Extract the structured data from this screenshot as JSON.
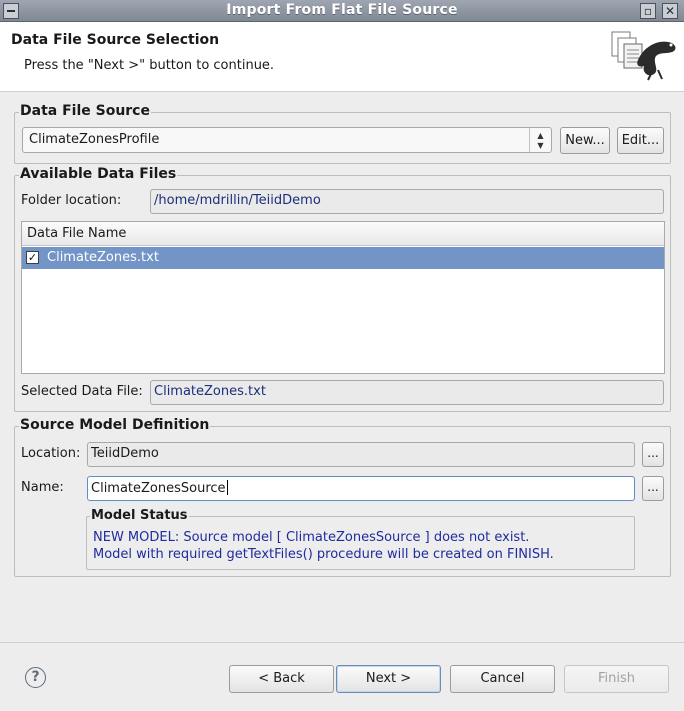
{
  "window": {
    "title": "Import From Flat File Source"
  },
  "banner": {
    "title": "Data File Source Selection",
    "message": "Press the \"Next >\" button to continue."
  },
  "data_file_source": {
    "group_title": "Data File Source",
    "profile_value": "ClimateZonesProfile",
    "new_label": "New...",
    "edit_label": "Edit..."
  },
  "available_files": {
    "group_title": "Available Data Files",
    "folder_label": "Folder location:",
    "folder_value": "/home/mdrillin/TeiidDemo",
    "column_header": "Data File Name",
    "rows": [
      {
        "name": "ClimateZones.txt",
        "checked": true
      }
    ],
    "selected_label": "Selected Data File:",
    "selected_value": "ClimateZones.txt"
  },
  "source_model": {
    "group_title": "Source Model Definition",
    "location_label": "Location:",
    "location_value": "TeiidDemo",
    "name_label": "Name:",
    "name_value": "ClimateZonesSource",
    "browse_label": "...",
    "status_title": "Model Status",
    "status_line1": "NEW MODEL: Source model [ ClimateZonesSource ] does not exist.",
    "status_line2": "Model with required getTextFiles() procedure will be created on FINISH."
  },
  "footer": {
    "help_glyph": "?",
    "back_label": "< Back",
    "next_label": "Next >",
    "cancel_label": "Cancel",
    "finish_label": "Finish"
  },
  "colors": {
    "selection": "#7294c6",
    "link_text": "#1f2c9e"
  },
  "icons": {
    "window_menu": "window-menu-icon",
    "maximize": "maximize-icon",
    "close": "close-icon",
    "wizard_banner": "wizard-banner-icon",
    "combo_arrow": "updown-arrows-icon",
    "help": "help-icon",
    "checkbox": "checkbox-checked-icon"
  }
}
